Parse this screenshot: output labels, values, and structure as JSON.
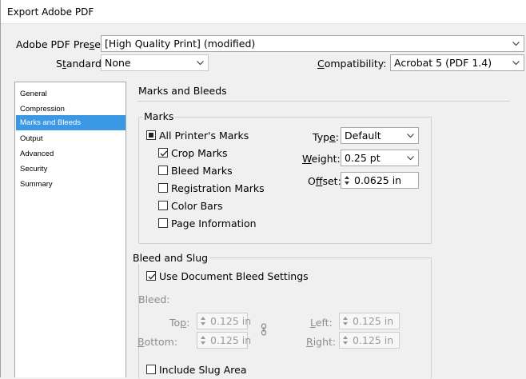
{
  "window": {
    "title": "Export Adobe PDF"
  },
  "preset": {
    "label": "Adobe PDF Preset:",
    "value": "[High Quality Print] (modified)"
  },
  "standard": {
    "label": "Standard:",
    "value": "None"
  },
  "compatibility": {
    "label": "Compatibility:",
    "value": "Acrobat 5 (PDF 1.4)"
  },
  "sidebar": {
    "items": [
      {
        "label": "General"
      },
      {
        "label": "Compression"
      },
      {
        "label": "Marks and Bleeds"
      },
      {
        "label": "Output"
      },
      {
        "label": "Advanced"
      },
      {
        "label": "Security"
      },
      {
        "label": "Summary"
      }
    ]
  },
  "panel": {
    "title": "Marks and Bleeds"
  },
  "marks": {
    "title": "Marks",
    "all_printers_marks": "All Printer's Marks",
    "crop_marks": "Crop Marks",
    "bleed_marks": "Bleed Marks",
    "registration_marks": "Registration Marks",
    "color_bars": "Color Bars",
    "page_information": "Page Information",
    "type_label": "Type:",
    "type_value": "Default",
    "weight_label": "Weight:",
    "weight_value": "0.25 pt",
    "offset_label": "Offset:",
    "offset_value": "0.0625 in"
  },
  "bleed": {
    "title": "Bleed and Slug",
    "use_document": "Use Document Bleed Settings",
    "bleed_label": "Bleed:",
    "top_label": "Top:",
    "top_value": "0.125 in",
    "bottom_label": "Bottom:",
    "bottom_value": "0.125 in",
    "left_label": "Left:",
    "left_value": "0.125 in",
    "right_label": "Right:",
    "right_value": "0.125 in",
    "include_slug": "Include Slug Area"
  }
}
